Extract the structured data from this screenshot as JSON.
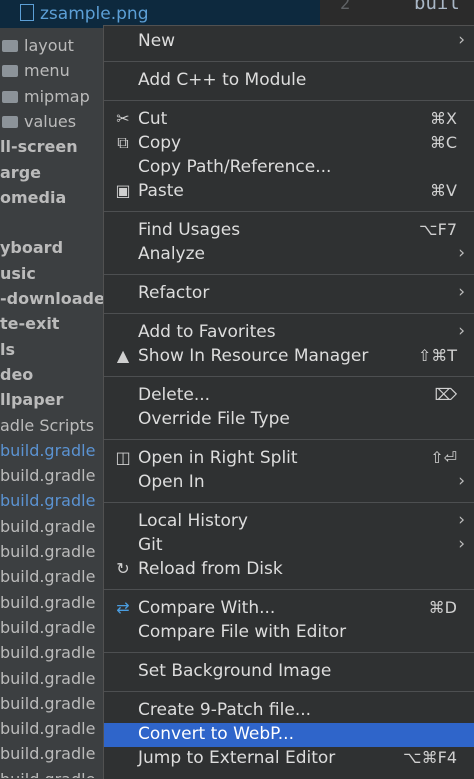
{
  "editor": {
    "line_number": "2",
    "code_fragment": "buil"
  },
  "tree": {
    "selected_file": "zsample.png",
    "rows": [
      {
        "label": "layout",
        "kind": "folder"
      },
      {
        "label": "menu",
        "kind": "folder"
      },
      {
        "label": "mipmap",
        "kind": "folder"
      },
      {
        "label": "values",
        "kind": "folder"
      },
      {
        "label": "ll-screen",
        "kind": "bold"
      },
      {
        "label": "arge",
        "kind": "bold"
      },
      {
        "label": "omedia",
        "kind": "bold"
      },
      {
        "label": "",
        "kind": "blank"
      },
      {
        "label": "yboard",
        "kind": "bold"
      },
      {
        "label": "usic",
        "kind": "bold"
      },
      {
        "label": "-downloader",
        "kind": "bold"
      },
      {
        "label": "te-exit",
        "kind": "bold"
      },
      {
        "label": "ls",
        "kind": "bold"
      },
      {
        "label": "deo",
        "kind": "bold"
      },
      {
        "label": "llpaper",
        "kind": "bold"
      },
      {
        "label": "adle Scripts",
        "kind": "normal"
      },
      {
        "label": "build.gradle",
        "kind": "blue"
      },
      {
        "label": "build.gradle",
        "kind": "normal"
      },
      {
        "label": "build.gradle",
        "kind": "blue"
      },
      {
        "label": "build.gradle",
        "kind": "normal"
      },
      {
        "label": "build.gradle",
        "kind": "normal"
      },
      {
        "label": "build.gradle",
        "kind": "normal"
      },
      {
        "label": "build.gradle",
        "kind": "normal"
      },
      {
        "label": "build.gradle",
        "kind": "normal"
      },
      {
        "label": "build.gradle",
        "kind": "normal"
      },
      {
        "label": "build.gradle",
        "kind": "normal"
      },
      {
        "label": "build.gradle",
        "kind": "normal"
      },
      {
        "label": "build.gradle",
        "kind": "normal"
      },
      {
        "label": "build.gradle",
        "kind": "normal"
      },
      {
        "label": "build.gradle",
        "kind": "normal"
      },
      {
        "label": "build.gradle",
        "kind": "normal"
      }
    ]
  },
  "menu": {
    "highlight_color": "#2f65ca",
    "items": [
      {
        "label": "New",
        "shortcut": "",
        "submenu": true,
        "icon": ""
      },
      {
        "sep": true
      },
      {
        "label": "Add C++ to Module",
        "shortcut": "",
        "submenu": false,
        "icon": ""
      },
      {
        "sep": true
      },
      {
        "label": "Cut",
        "shortcut": "⌘X",
        "submenu": false,
        "icon": "scissors-icon",
        "glyph": "✂"
      },
      {
        "label": "Copy",
        "shortcut": "⌘C",
        "submenu": false,
        "icon": "copy-icon",
        "glyph": "⧉"
      },
      {
        "label": "Copy Path/Reference...",
        "shortcut": "",
        "submenu": false,
        "icon": ""
      },
      {
        "label": "Paste",
        "shortcut": "⌘V",
        "submenu": false,
        "icon": "clipboard-icon",
        "glyph": "▣"
      },
      {
        "sep": true
      },
      {
        "label": "Find Usages",
        "shortcut": "⌥F7",
        "submenu": false,
        "icon": ""
      },
      {
        "label": "Analyze",
        "shortcut": "",
        "submenu": true,
        "icon": ""
      },
      {
        "sep": true
      },
      {
        "label": "Refactor",
        "shortcut": "",
        "submenu": true,
        "icon": ""
      },
      {
        "sep": true
      },
      {
        "label": "Add to Favorites",
        "shortcut": "",
        "submenu": true,
        "icon": ""
      },
      {
        "label": "Show In Resource Manager",
        "shortcut": "⇧⌘T",
        "submenu": false,
        "icon": "resource-manager-icon",
        "glyph": "▲"
      },
      {
        "sep": true
      },
      {
        "label": "Delete...",
        "shortcut": "⌦",
        "submenu": false,
        "icon": ""
      },
      {
        "label": "Override File Type",
        "shortcut": "",
        "submenu": false,
        "icon": ""
      },
      {
        "sep": true
      },
      {
        "label": "Open in Right Split",
        "shortcut": "⇧⏎",
        "submenu": false,
        "icon": "split-icon",
        "glyph": "◫"
      },
      {
        "label": "Open In",
        "shortcut": "",
        "submenu": true,
        "icon": ""
      },
      {
        "sep": true
      },
      {
        "label": "Local History",
        "shortcut": "",
        "submenu": true,
        "icon": ""
      },
      {
        "label": "Git",
        "shortcut": "",
        "submenu": true,
        "icon": ""
      },
      {
        "label": "Reload from Disk",
        "shortcut": "",
        "submenu": false,
        "icon": "reload-icon",
        "glyph": "↻"
      },
      {
        "sep": true
      },
      {
        "label": "Compare With...",
        "shortcut": "⌘D",
        "submenu": false,
        "icon": "compare-icon",
        "glyph": "⇄"
      },
      {
        "label": "Compare File with Editor",
        "shortcut": "",
        "submenu": false,
        "icon": ""
      },
      {
        "sep": true
      },
      {
        "label": "Set Background Image",
        "shortcut": "",
        "submenu": false,
        "icon": ""
      },
      {
        "sep": true
      },
      {
        "label": "Create 9-Patch file...",
        "shortcut": "",
        "submenu": false,
        "icon": ""
      },
      {
        "label": "Convert to WebP...",
        "shortcut": "",
        "submenu": false,
        "icon": "",
        "highlighted": true
      },
      {
        "label": "Jump to External Editor",
        "shortcut": "⌥⌘F4",
        "submenu": false,
        "icon": ""
      }
    ]
  }
}
